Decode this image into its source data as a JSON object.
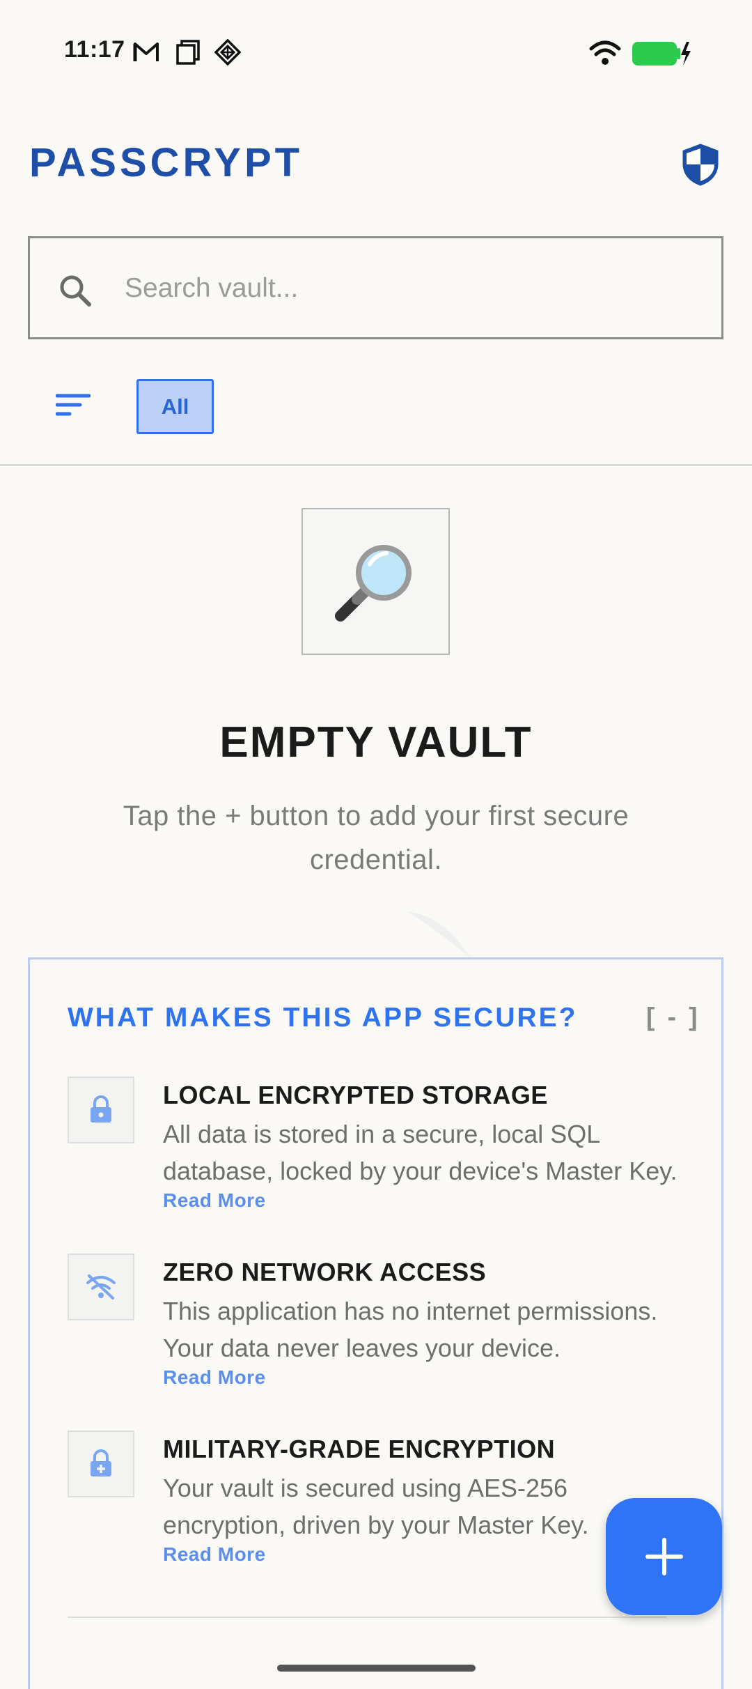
{
  "status_bar": {
    "time": "11:17",
    "battery_color": "#2ccb4e",
    "icons": [
      "gmail-icon",
      "screenshot-icon",
      "shield-diamond-icon",
      "wifi-icon",
      "battery-charging-icon"
    ]
  },
  "header": {
    "title": "PASSCRYPT",
    "brand_color": "#1f4ea8",
    "shield_icon": "shield-icon"
  },
  "search": {
    "placeholder": "Search vault...",
    "value": "",
    "icon": "search-icon"
  },
  "filters": {
    "sort_icon": "sort-icon",
    "chips": [
      {
        "label": "All",
        "selected": true
      }
    ],
    "accent_color": "#2f6ff0"
  },
  "empty_state": {
    "icon": "magnifier-icon",
    "title": "EMPTY VAULT",
    "subtitle": "Tap the + button to add your first secure credential."
  },
  "security_card": {
    "title": "WHAT MAKES THIS APP SECURE?",
    "toggle_label": "[ - ]",
    "title_color": "#2f73ef",
    "features": [
      {
        "icon": "lock-icon",
        "title": "LOCAL ENCRYPTED STORAGE",
        "description": "All data is stored in a secure, local SQL database, locked by your device's Master Key.",
        "link": "Read More"
      },
      {
        "icon": "wifi-off-icon",
        "title": "ZERO NETWORK ACCESS",
        "description": "This application has no internet permissions. Your data never leaves your device.",
        "link": "Read More"
      },
      {
        "icon": "lock-plus-icon",
        "title": "MILITARY-GRADE ENCRYPTION",
        "description": "Your vault is secured using AES-256 encryption, driven by your Master Key.",
        "link": "Read More"
      }
    ]
  },
  "fab": {
    "label": "+",
    "color": "#2f74f6"
  }
}
